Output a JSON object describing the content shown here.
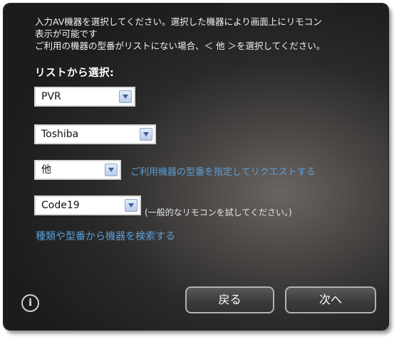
{
  "instructions": {
    "line1": "入力AV機器を選択してください。選択した機器により画面上にリモコン",
    "line2": "表示が可能です",
    "line3": "ご利用の機器の型番がリストにない場合、＜ 他 ＞を選択してください。"
  },
  "list_heading": "リストから選択:",
  "selects": {
    "device_type": "PVR",
    "brand": "Toshiba",
    "model": "他",
    "code": "Code19"
  },
  "links": {
    "request_model": "ご利用機器の型番を指定してリクエストする",
    "search_devices": "種類や型番から機器を検索する"
  },
  "code_note": "(一般的なリモコンを試してください。)",
  "info_icon": "i",
  "buttons": {
    "back": "戻る",
    "next": "次へ"
  },
  "colors": {
    "link": "#5b9fd8",
    "dialog_bg": "#2b2a2a"
  }
}
